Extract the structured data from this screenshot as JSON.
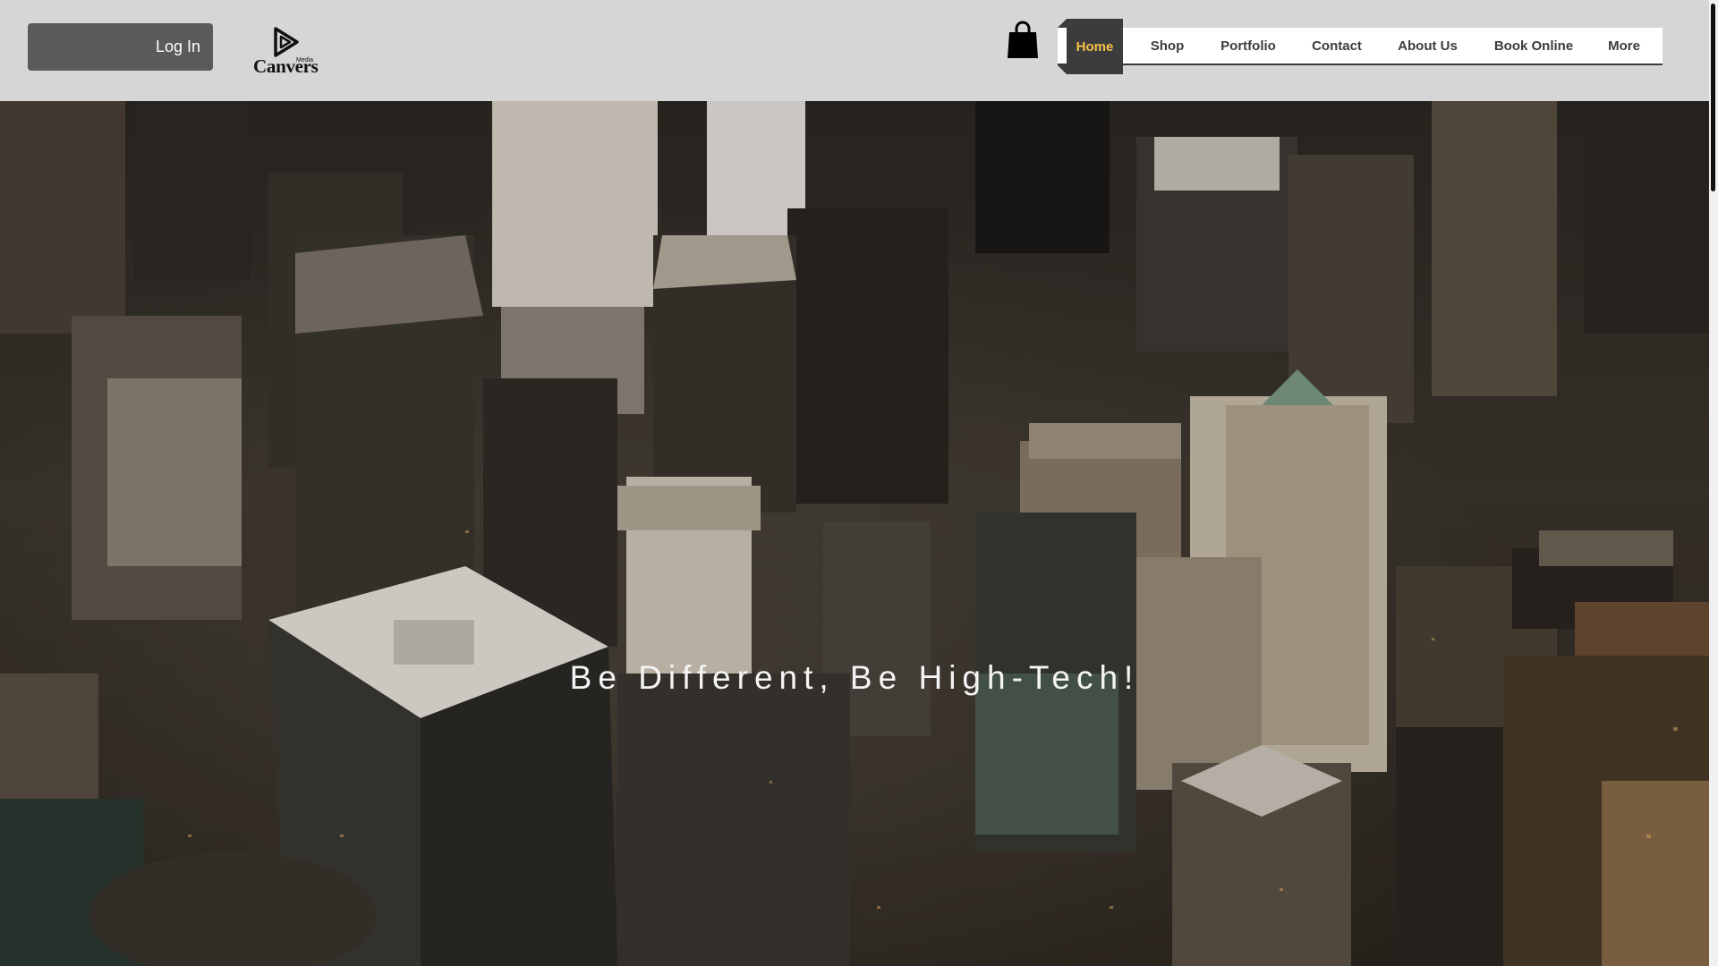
{
  "header": {
    "login_label": "Log In",
    "logo": {
      "brand": "Canvers",
      "sub": "Media"
    },
    "cart_icon": "shopping-bag-icon"
  },
  "menu": {
    "items": [
      {
        "label": "Home",
        "active": true
      },
      {
        "label": "Shop"
      },
      {
        "label": "Portfolio"
      },
      {
        "label": "Contact"
      },
      {
        "label": "About Us"
      },
      {
        "label": "Book Online"
      },
      {
        "label": "More"
      }
    ]
  },
  "hero": {
    "title": "Be Different, Be High-Tech!",
    "background": "aerial-city-night-photo"
  },
  "colors": {
    "header_bg": "#d6d6d6",
    "login_bg": "#5a5a5a",
    "menu_active_bg": "#3c3c3c",
    "menu_active_text": "#f5c249",
    "menu_text": "#3c3c3c"
  }
}
